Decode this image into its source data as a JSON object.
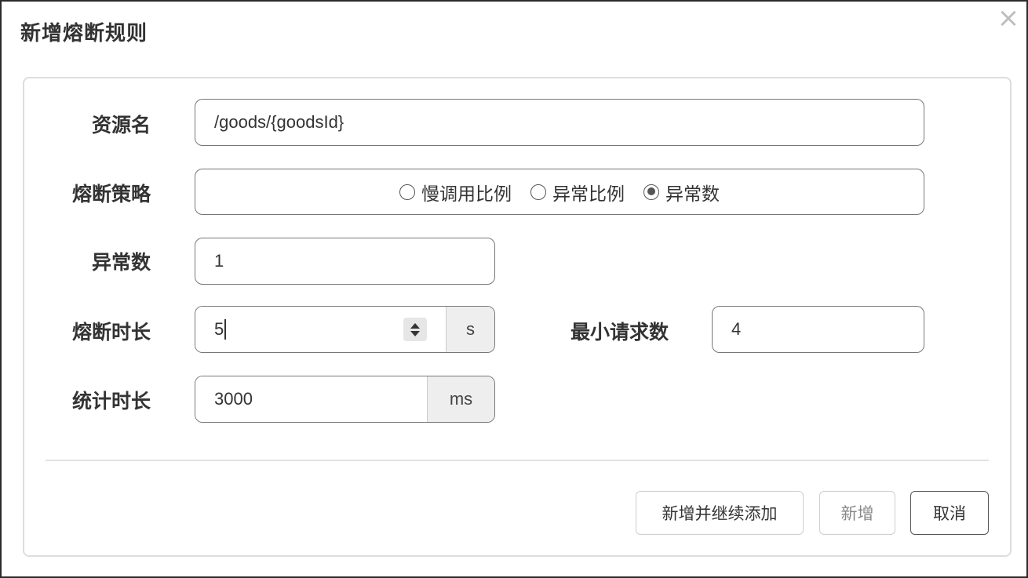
{
  "dialog": {
    "title": "新增熔断规则",
    "close_icon": "close-icon"
  },
  "form": {
    "resource": {
      "label": "资源名",
      "value": "/goods/{goodsId}"
    },
    "strategy": {
      "label": "熔断策略",
      "options": [
        "慢调用比例",
        "异常比例",
        "异常数"
      ],
      "selected": "异常数"
    },
    "exception_count": {
      "label": "异常数",
      "value": "1"
    },
    "break_duration": {
      "label": "熔断时长",
      "value": "5",
      "unit": "s"
    },
    "min_requests": {
      "label": "最小请求数",
      "value": "4"
    },
    "stat_duration": {
      "label": "统计时长",
      "value": "3000",
      "unit": "ms"
    }
  },
  "buttons": {
    "add_continue": "新增并继续添加",
    "add": "新增",
    "cancel": "取消"
  }
}
